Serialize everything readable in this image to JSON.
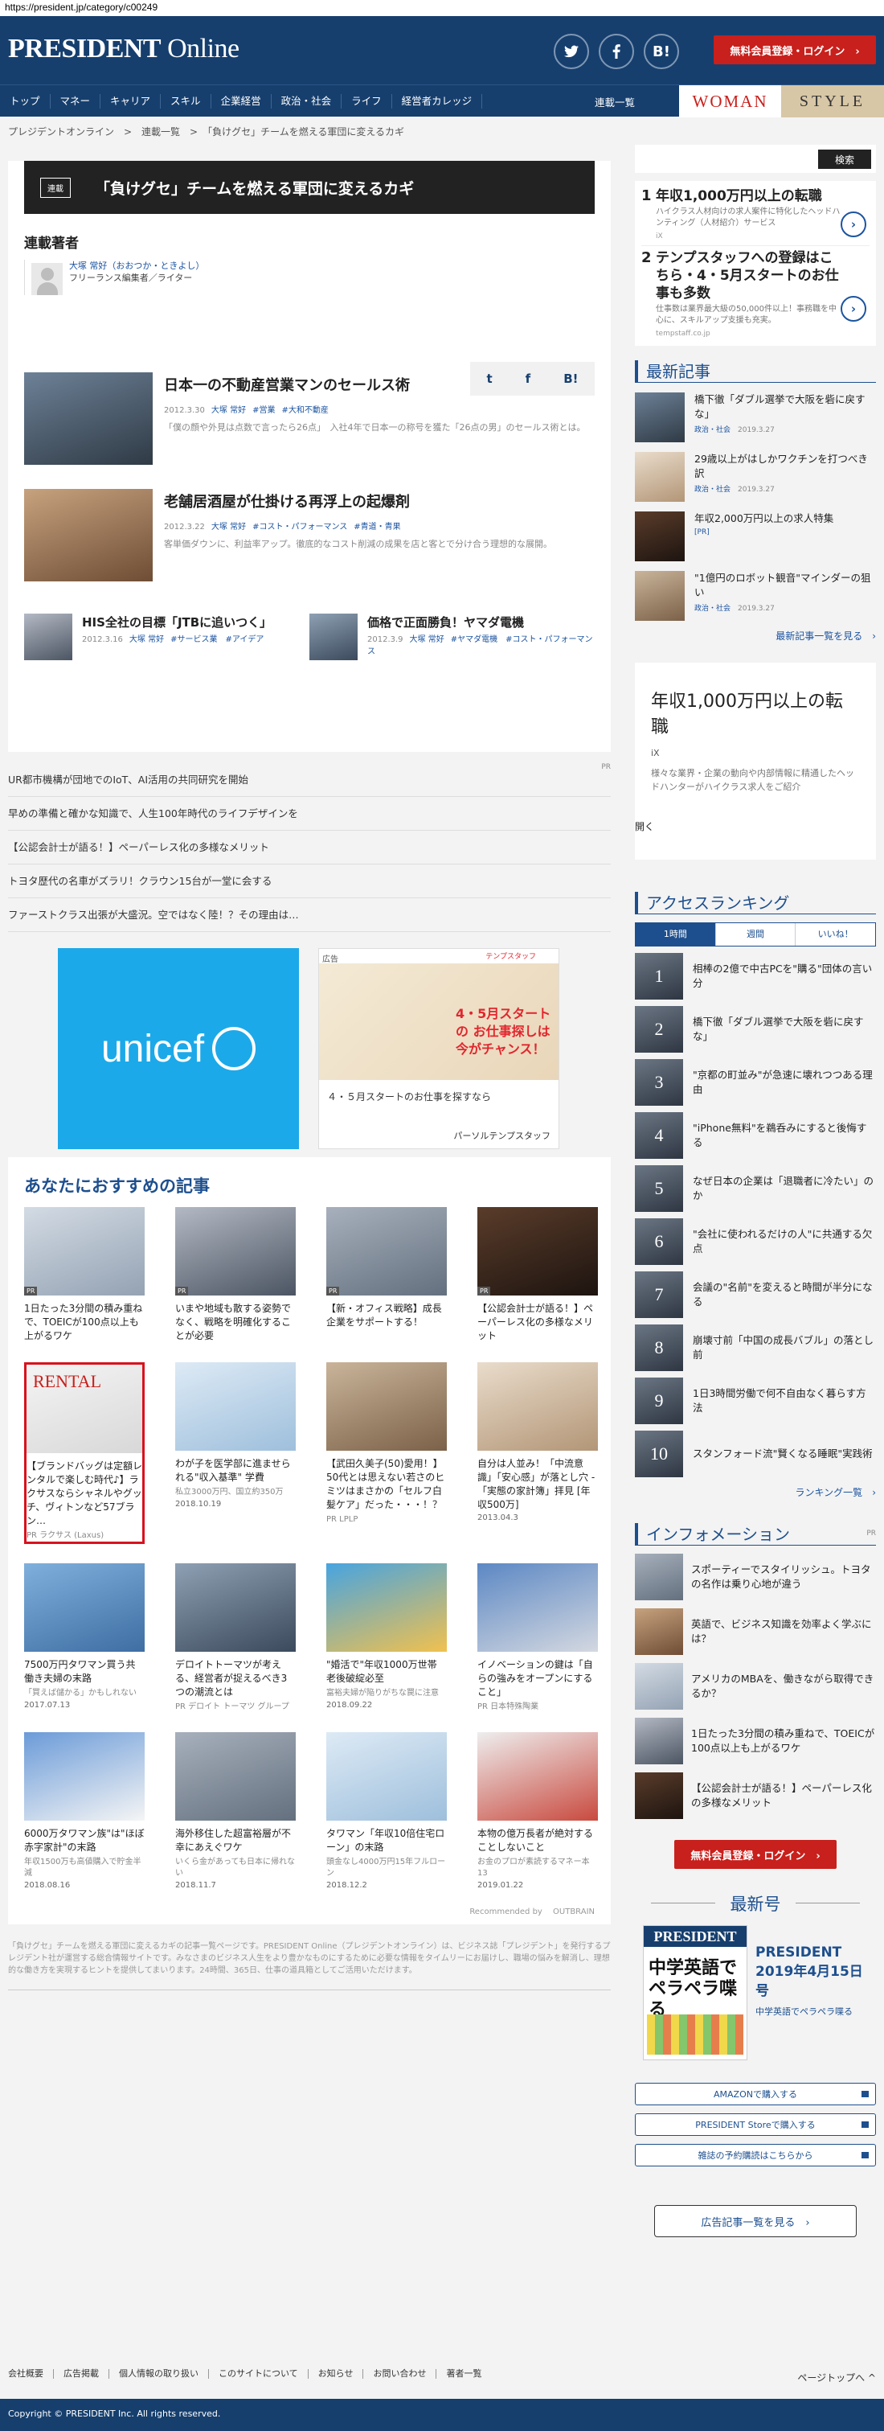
{
  "url": "https://president.jp/category/c00249",
  "header": {
    "logo_main": "PRESIDENT",
    "logo_sub": "Online",
    "login_button": "無料会員登録・ログイン　›",
    "hatena": "B!"
  },
  "nav": {
    "items": [
      "トップ",
      "マネー",
      "キャリア",
      "スキル",
      "企業経営",
      "政治・社会",
      "ライフ",
      "経営者カレッジ"
    ],
    "more": "連載一覧",
    "woman": "WOMAN",
    "style": "STYLE"
  },
  "breadcrumb": "プレジデントオンライン　>　連載一覧　>　「負けグセ」チームを燃える軍団に変えるカギ",
  "series": {
    "tag": "連載",
    "title": "「負けグセ」チームを燃える軍団に変えるカギ",
    "authors_heading": "連載著者",
    "author_name": "大塚 常好（おおつか・ときよし）",
    "author_role": "フリーランス編集者／ライター"
  },
  "share": {
    "twitter": "t",
    "facebook": "f",
    "hatena": "B!"
  },
  "articles": [
    {
      "title": "日本一の不動産営業マンのセールス術",
      "date": "2012.3.30",
      "author": "大塚 常好",
      "tags": [
        "#営業",
        "#大和不動産"
      ],
      "desc": "「僕の顔や外見は点数で言ったら26点」　入社4年で日本一の称号を獲た「26点の男」のセールス術とは。"
    },
    {
      "title": "老舗居酒屋が仕掛ける再浮上の起爆剤",
      "date": "2012.3.22",
      "author": "大塚 常好",
      "tags": [
        "#コスト・パフォーマンス",
        "#青道・青果"
      ],
      "desc": "客単価ダウンに、利益率アップ。徹底的なコスト削減の成果を店と客とで分け合う理想的な展開。"
    }
  ],
  "small_articles": [
    {
      "title": "HIS全社の目標「JTBに追いつく」",
      "date": "2012.3.16",
      "author": "大塚 常好",
      "tags": "#サービス業　#アイデア"
    },
    {
      "title": "価格で正面勝負！ヤマダ電機",
      "date": "2012.3.9",
      "author": "大塚 常好",
      "tags": "#ヤマダ電機　#コスト・パフォーマンス"
    }
  ],
  "pr": {
    "label": "PR",
    "items": [
      "UR都市機構が団地でのIoT、AI活用の共同研究を開始",
      "早めの準備と確かな知識で、人生100年時代のライフデザインを",
      "【公認会計士が語る！】ペーパーレス化の多様なメリット",
      "トヨタ歴代の名車がズラリ！クラウン15台が一堂に会する",
      "ファーストクラス出張が大盛況。空ではなく陸！？その理由は…"
    ]
  },
  "ads": {
    "unicef": "unicef",
    "ad_label": "広告",
    "ad_sponsor_logo": "テンプスタッフ",
    "ad_copy": "4・5月スタートの お仕事探しは 今がチャンス！",
    "ad_text": "４・５月スタートのお仕事を探すなら",
    "ad_sponsor": "パーソルテンプスタッフ"
  },
  "recommend": {
    "heading": "あなたにおすすめの記事",
    "cards": [
      {
        "title": "1日たった3分間の積み重ねで、TOEICが100点以上も上がるワケ",
        "sub": "",
        "date": "",
        "pr": true
      },
      {
        "title": "いまや地域も散する姿勢でなく、戦略を明確化することが必要",
        "sub": "",
        "date": "",
        "pr": true
      },
      {
        "title": "【新・オフィス戦略】成長企業をサポートする！",
        "sub": "",
        "date": "",
        "pr": true
      },
      {
        "title": "【公認会計士が語る！】ペーパーレス化の多様なメリット",
        "sub": "",
        "date": "",
        "pr": true
      },
      {
        "title": "【ブランドバッグは定額レンタルで楽しむ時代♪】ラクサスならシャネルやグッチ、ヴィトンなど57ブラン…",
        "sub": "PR ラクサス (Laxus)",
        "date": "",
        "pr": false,
        "highlight": true,
        "thumb_text": "RENTAL"
      },
      {
        "title": "わが子を医学部に進ませられる\"収入基準\" 学費",
        "sub": "私立3000万円、国立約350万",
        "date": "2018.10.19",
        "pr": false
      },
      {
        "title": "【武田久美子(50)愛用！】50代とは思えない若さのヒミツはまさかの「セルフ白髪ケア」だった・・・！？",
        "sub": "PR LPLP",
        "date": "",
        "pr": false
      },
      {
        "title": "自分は人並み！「中流意識」「安心感」が落とし穴 ‐ 「実態の家計簿」拝見 [年収500万]",
        "sub": "",
        "date": "2013.04.3",
        "pr": false
      },
      {
        "title": "7500万円タワマン買う共働き夫婦の末路",
        "sub": "「買えば儲かる」かもしれない",
        "date": "2017.07.13",
        "pr": false
      },
      {
        "title": "デロイトトーマツが考える、経営者が捉えるべき3つの潮流とは",
        "sub": "PR デロイト トーマツ グループ",
        "date": "",
        "pr": false
      },
      {
        "title": "\"婚活で\"年収1000万世帯 老後破綻必至",
        "sub": "富裕夫婦が陥りがちな罠に注意",
        "date": "2018.09.22",
        "pr": false
      },
      {
        "title": "イノベーションの鍵は「自らの強みをオープンにすること」",
        "sub": "PR 日本特殊陶業",
        "date": "",
        "pr": false
      },
      {
        "title": "6000万タワマン族\"は\"ほぼ赤字家計\"の末路",
        "sub": "年収1500万も高値購入で貯金半減",
        "date": "2018.08.16",
        "pr": false
      },
      {
        "title": "海外移住した超富裕層が不幸にあえぐワケ",
        "sub": "いくら金があっても日本に帰れない",
        "date": "2018.11.7",
        "pr": false
      },
      {
        "title": "タワマン「年収10倍住宅ローン」の末路",
        "sub": "頭金なし4000万円15年フルローン",
        "date": "2018.12.2",
        "pr": false
      },
      {
        "title": "本物の億万長者が絶対することしないこと",
        "sub": "お金のプロが素読するマネー本13",
        "date": "2019.01.22",
        "pr": false
      }
    ],
    "recommended_by": "Recommended by 　OUTBRAIN"
  },
  "site_desc": "「負けグセ」チームを燃える軍団に変えるカギの記事一覧ページです。PRESIDENT Online（プレジデントオンライン）は、ビジネス誌「プレジデント」を発行するプレジデント社が運営する総合情報サイトです。みなさまのビジネス人生をより豊かなものにするために必要な情報をタイムリーにお届けし、職場の悩みを解消し、理想的な働き方を実現するヒントを提供してまいります。24時間、365日、仕事の道具箱としてご活用いただけます。",
  "sidebar": {
    "search_button": "検索",
    "jobs": [
      {
        "num": "1",
        "title": "年収1,000万円以上の転職",
        "desc": "ハイクラス人材向けの求人案件に特化したヘッドハンティング（人材紹介）サービス",
        "src": "iX"
      },
      {
        "num": "2",
        "title": "テンプスタッフへの登録はこちら・4・5月スタートのお仕事も多数",
        "desc": "仕事数は業界最大級の50,000件以上！事務職を中心に、スキルアップ支援も充実。",
        "src": "tempstaff.co.jp"
      }
    ],
    "latest_title": "最新記事",
    "latest": [
      {
        "title": "橋下徹「ダブル選挙で大阪を砦に戻すな」",
        "cat": "政治・社会",
        "date": "2019.3.27"
      },
      {
        "title": "29歳以上がはしかワクチンを打つべき訳",
        "cat": "政治・社会",
        "date": "2019.3.27"
      },
      {
        "title": "年収2,000万円以上の求人特集",
        "cat": "[PR]",
        "date": ""
      },
      {
        "title": "\"1億円のロボット観音\"マインダーの狙い",
        "cat": "政治・社会",
        "date": "2019.3.27"
      }
    ],
    "latest_more": "最新記事一覧を見る　›",
    "ad": {
      "title": "年収1,000万円以上の転職",
      "src": "iX",
      "desc": "様々な業界・企業の動向や内部情報に精通したヘッドハンターがハイクラス求人をご紹介",
      "button": "開く"
    },
    "ranking_title": "アクセスランキング",
    "ranking_tabs": [
      "1時間",
      "週間",
      "いいね！"
    ],
    "ranking": [
      {
        "n": "1",
        "title": "相棒の2億で中古PCを\"購る\"団体の言い分"
      },
      {
        "n": "2",
        "title": "橋下徹「ダブル選挙で大阪を砦に戻すな」"
      },
      {
        "n": "3",
        "title": "\"京都の町並み\"が急速に壊れつつある理由"
      },
      {
        "n": "4",
        "title": "\"iPhone無料\"を鵜呑みにすると後悔する"
      },
      {
        "n": "5",
        "title": "なぜ日本の企業は「退職者に冷たい」のか"
      },
      {
        "n": "6",
        "title": "\"会社に使われるだけの人\"に共通する欠点"
      },
      {
        "n": "7",
        "title": "会議の\"名前\"を変えると時間が半分になる"
      },
      {
        "n": "8",
        "title": "崩壊寸前「中国の成長バブル」の落とし前"
      },
      {
        "n": "9",
        "title": "1日3時間労働で何不自由なく暮らす方法"
      },
      {
        "n": "10",
        "title": "スタンフォード流\"賢くなる睡眠\"実践術"
      }
    ],
    "ranking_more": "ランキング一覧　›",
    "info_title": "インフォメーション",
    "info_pr": "PR",
    "info": [
      "スポーティーでスタイリッシュ。トヨタの名作は乗り心地が違う",
      "英語で、ビジネス知識を効率よく学ぶには？",
      "アメリカのMBAを、働きながら取得できるか？",
      "1日たった3分間の積み重ねで、TOEICが100点以上も上がるワケ",
      "【公認会計士が語る！】ペーパーレス化の多様なメリット"
    ],
    "login_button": "無料会員登録・ログイン　›",
    "newest_title": "最新号",
    "mag_brand": "PRESIDENT",
    "mag_cover_head": "中学英語でペラペラ喋る",
    "mag_issue": "PRESIDENT 2019年4月15日号",
    "mag_issue_sub": "中学英語でペラペラ喋る",
    "buy": [
      "AMAZONで購入する",
      "PRESIDENT Storeで購入する",
      "雑誌の予約購読はこちらから"
    ],
    "ad_list": "広告記事一覧を見る　›"
  },
  "footer": {
    "links": [
      "会社概要",
      "広告掲載",
      "個人情報の取り扱い",
      "このサイトについて",
      "お知らせ",
      "お問い合わせ",
      "著者一覧"
    ],
    "page_top": "ページトップへ ^",
    "copyright": "Copyright © PRESIDENT Inc. All rights reserved."
  }
}
